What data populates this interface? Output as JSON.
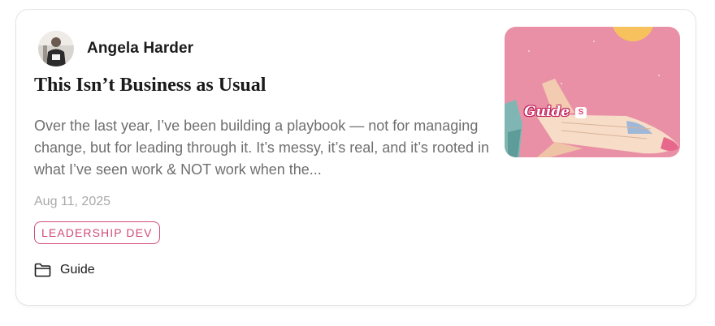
{
  "post": {
    "author": {
      "name": "Angela Harder",
      "avatar_icon": "person-avatar"
    },
    "title": "This Isn’t Business as Usual",
    "excerpt": "Over the last year, I’ve been building a playbook — not for managing change, but for leading through it. It’s messy, it’s real, and it’s rooted in what I’ve seen work & NOT work when the...",
    "date": "Aug 11, 2025",
    "tag": "LEADERSHIP DEV",
    "category": {
      "label": "Guide",
      "icon": "folder-icon"
    },
    "thumbnail": {
      "label": "Guide",
      "badge": "S",
      "description_icon": "rocket-illustration"
    }
  },
  "colors": {
    "tag_accent": "#d14a78",
    "thumbnail_bg": "#e990a6",
    "date_text": "#a9a9a9",
    "excerpt_text": "#6f6f6f"
  }
}
